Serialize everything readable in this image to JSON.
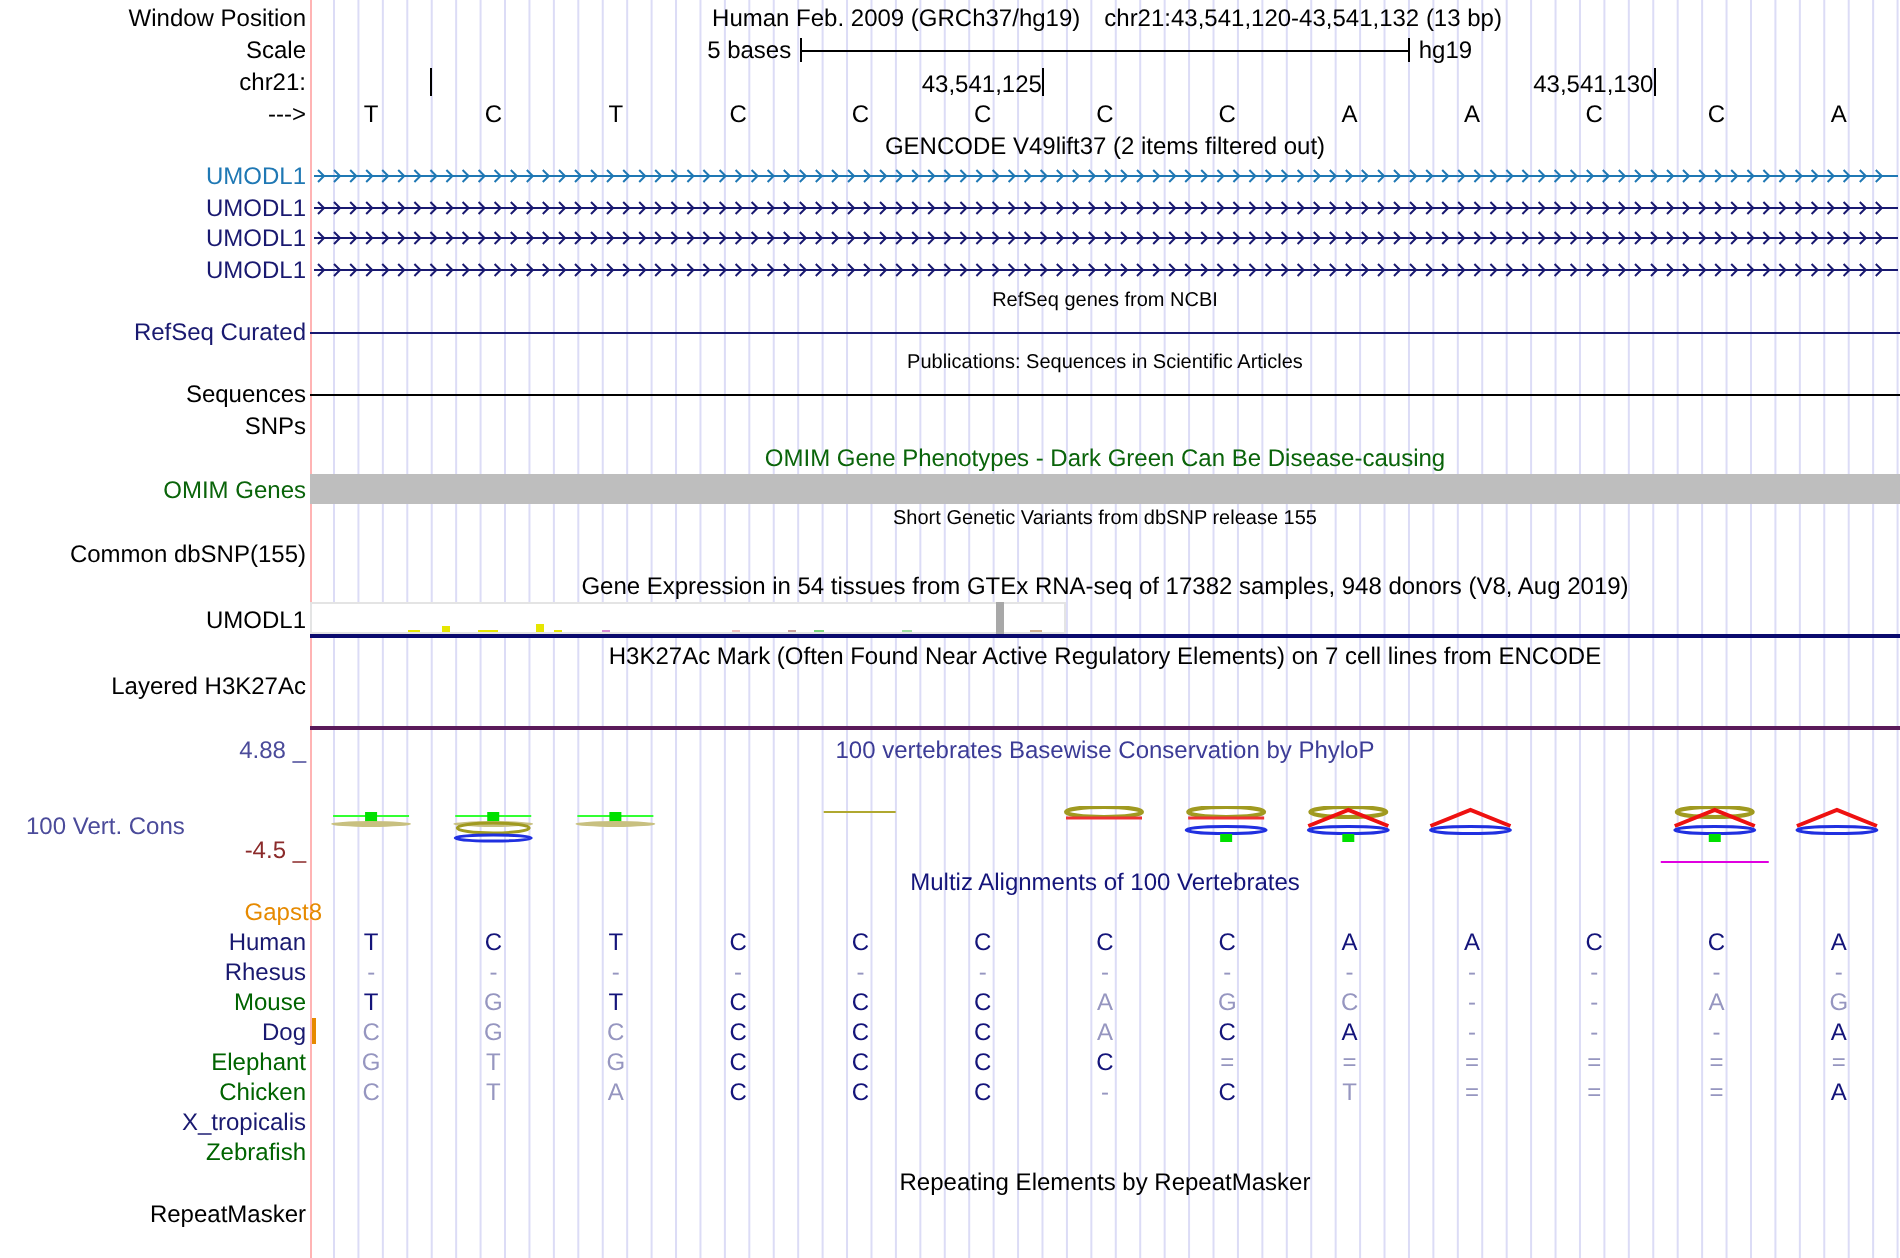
{
  "position": {
    "label": "Window Position",
    "assembly": "Human Feb. 2009 (GRCh37/hg19)",
    "range": "chr21:43,541,120-43,541,132 (13 bp)"
  },
  "scale": {
    "label": "Scale",
    "span": "5 bases",
    "assembly": "hg19"
  },
  "ruler": {
    "label": "chr21:",
    "ticks": [
      "43,541,125",
      "43,541,130"
    ]
  },
  "strand": {
    "label": "--->",
    "bases": [
      "T",
      "C",
      "T",
      "C",
      "C",
      "C",
      "C",
      "C",
      "A",
      "A",
      "C",
      "C",
      "A"
    ]
  },
  "gencode": {
    "title": "GENCODE V49lift37 (2 items filtered out)",
    "items": [
      {
        "name": "UMODL1",
        "color": "#1f78b4"
      },
      {
        "name": "UMODL1",
        "color": "#191970"
      },
      {
        "name": "UMODL1",
        "color": "#191970"
      },
      {
        "name": "UMODL1",
        "color": "#191970"
      }
    ]
  },
  "refseq": {
    "title": "RefSeq genes from NCBI",
    "label": "RefSeq Curated"
  },
  "publications": {
    "title": "Publications: Sequences in Scientific Articles",
    "label": "Sequences"
  },
  "snps": {
    "label": "SNPs"
  },
  "omim": {
    "title": "OMIM Gene Phenotypes - Dark Green Can Be Disease-causing",
    "label": "OMIM Genes"
  },
  "dbsnp": {
    "title": "Short Genetic Variants from dbSNP release 155",
    "label": "Common dbSNP(155)"
  },
  "gtex": {
    "title": "Gene Expression in 54 tissues from GTEx RNA-seq of 17382 samples, 948 donors (V8, Aug 2019)",
    "label": "UMODL1"
  },
  "h3k27ac": {
    "title": "H3K27Ac Mark (Often Found Near Active Regulatory Elements) on 7 cell lines from ENCODE",
    "label": "Layered H3K27Ac"
  },
  "phylop": {
    "title": "100 vertebrates Basewise Conservation by PhyloP",
    "label": "100 Vert. Cons",
    "max": "4.88 _",
    "min": "-4.5 _"
  },
  "multiz": {
    "title": "Multiz Alignments of 100 Vertebrates",
    "gaps_label": "Gapst8",
    "species": [
      {
        "name": "Human",
        "color": "#191970",
        "gap": false,
        "cells": [
          {
            "text": "T",
            "match": true
          },
          {
            "text": "C",
            "match": true
          },
          {
            "text": "T",
            "match": true
          },
          {
            "text": "C",
            "match": true
          },
          {
            "text": "C",
            "match": true
          },
          {
            "text": "C",
            "match": true
          },
          {
            "text": "C",
            "match": true
          },
          {
            "text": "C",
            "match": true
          },
          {
            "text": "A",
            "match": true
          },
          {
            "text": "A",
            "match": true
          },
          {
            "text": "C",
            "match": true
          },
          {
            "text": "C",
            "match": true
          },
          {
            "text": "A",
            "match": true
          }
        ]
      },
      {
        "name": "Rhesus",
        "color": "#191970",
        "gap": false,
        "cells": [
          {
            "text": "-",
            "match": false
          },
          {
            "text": "-",
            "match": false
          },
          {
            "text": "-",
            "match": false
          },
          {
            "text": "-",
            "match": false
          },
          {
            "text": "-",
            "match": false
          },
          {
            "text": "-",
            "match": false
          },
          {
            "text": "-",
            "match": false
          },
          {
            "text": "-",
            "match": false
          },
          {
            "text": "-",
            "match": false
          },
          {
            "text": "-",
            "match": false
          },
          {
            "text": "-",
            "match": false
          },
          {
            "text": "-",
            "match": false
          },
          {
            "text": "-",
            "match": false
          }
        ]
      },
      {
        "name": "Mouse",
        "color": "#006400",
        "gap": false,
        "cells": [
          {
            "text": "T",
            "match": true
          },
          {
            "text": "G",
            "match": false
          },
          {
            "text": "T",
            "match": true
          },
          {
            "text": "C",
            "match": true
          },
          {
            "text": "C",
            "match": true
          },
          {
            "text": "C",
            "match": true
          },
          {
            "text": "A",
            "match": false
          },
          {
            "text": "G",
            "match": false
          },
          {
            "text": "C",
            "match": false
          },
          {
            "text": "-",
            "match": false
          },
          {
            "text": "-",
            "match": false
          },
          {
            "text": "A",
            "match": false
          },
          {
            "text": "G",
            "match": false
          }
        ]
      },
      {
        "name": "Dog",
        "color": "#191970",
        "gap": true,
        "cells": [
          {
            "text": "C",
            "match": false
          },
          {
            "text": "G",
            "match": false
          },
          {
            "text": "C",
            "match": false
          },
          {
            "text": "C",
            "match": true
          },
          {
            "text": "C",
            "match": true
          },
          {
            "text": "C",
            "match": true
          },
          {
            "text": "A",
            "match": false
          },
          {
            "text": "C",
            "match": true
          },
          {
            "text": "A",
            "match": true
          },
          {
            "text": "-",
            "match": false
          },
          {
            "text": "-",
            "match": false
          },
          {
            "text": "-",
            "match": false
          },
          {
            "text": "A",
            "match": true
          }
        ]
      },
      {
        "name": "Elephant",
        "color": "#006400",
        "gap": false,
        "cells": [
          {
            "text": "G",
            "match": false
          },
          {
            "text": "T",
            "match": false
          },
          {
            "text": "G",
            "match": false
          },
          {
            "text": "C",
            "match": true
          },
          {
            "text": "C",
            "match": true
          },
          {
            "text": "C",
            "match": true
          },
          {
            "text": "C",
            "match": true
          },
          {
            "text": "=",
            "match": false
          },
          {
            "text": "=",
            "match": false
          },
          {
            "text": "=",
            "match": false
          },
          {
            "text": "=",
            "match": false
          },
          {
            "text": "=",
            "match": false
          },
          {
            "text": "=",
            "match": false
          }
        ]
      },
      {
        "name": "Chicken",
        "color": "#006400",
        "gap": false,
        "cells": [
          {
            "text": "C",
            "match": false
          },
          {
            "text": "T",
            "match": false
          },
          {
            "text": "A",
            "match": false
          },
          {
            "text": "C",
            "match": true
          },
          {
            "text": "C",
            "match": true
          },
          {
            "text": "C",
            "match": true
          },
          {
            "text": "-",
            "match": false
          },
          {
            "text": "C",
            "match": true
          },
          {
            "text": "T",
            "match": false
          },
          {
            "text": "=",
            "match": false
          },
          {
            "text": "=",
            "match": false
          },
          {
            "text": "=",
            "match": false
          },
          {
            "text": "A",
            "match": true
          }
        ]
      },
      {
        "name": "X_tropicalis",
        "color": "#191970",
        "gap": false
      },
      {
        "name": "Zebrafish",
        "color": "#006400",
        "gap": false
      }
    ]
  },
  "repeatmasker": {
    "title": "Repeating Elements by RepeatMasker",
    "label": "RepeatMasker"
  }
}
